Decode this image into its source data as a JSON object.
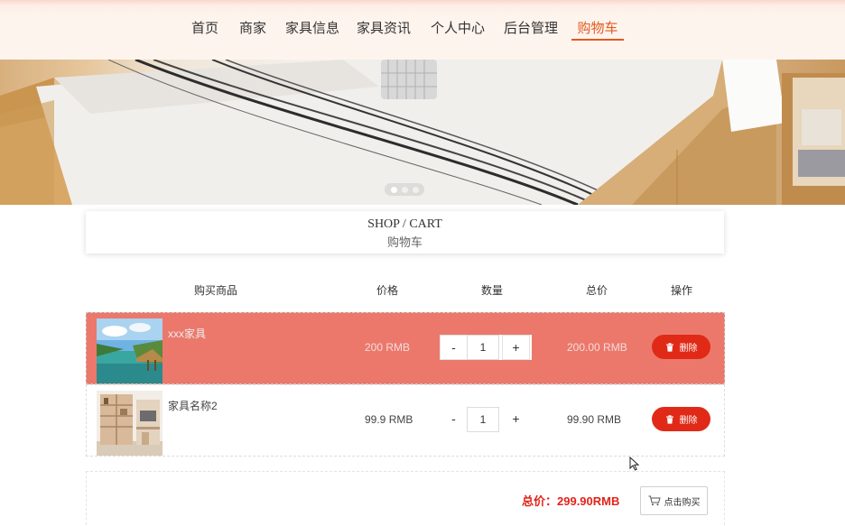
{
  "nav": {
    "items": [
      "首页",
      "商家",
      "家具信息",
      "家具资讯",
      "个人中心",
      "后台管理",
      "购物车"
    ],
    "active_index": 6
  },
  "banner": {
    "slide_count": 3,
    "active_slide": 1
  },
  "title": {
    "en": "SHOP / CART",
    "cn": "购物车"
  },
  "table": {
    "headers": {
      "product": "购买商品",
      "price": "价格",
      "quantity": "数量",
      "total": "总价",
      "action": "操作"
    }
  },
  "items": [
    {
      "name": "xxx家具",
      "price": "200 RMB",
      "quantity": "1",
      "minus": "-",
      "plus": "+",
      "total": "200.00 RMB",
      "delete": "删除",
      "selected": true
    },
    {
      "name": "家具名称2",
      "price": "99.9 RMB",
      "quantity": "1",
      "minus": "-",
      "plus": "+",
      "total": "99.90 RMB",
      "delete": "删除",
      "selected": false
    }
  ],
  "footer": {
    "sum": "总价：299.90RMB",
    "buy": "点击购买"
  },
  "colors": {
    "accent": "#e2591f",
    "selected_row": "#ec786c",
    "delete": "#e02a17",
    "sum": "#e2231a"
  }
}
